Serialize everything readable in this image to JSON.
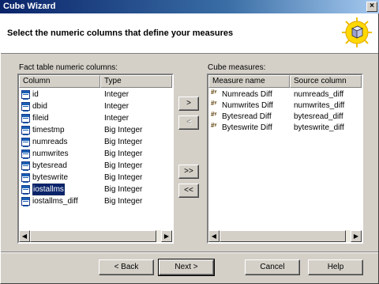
{
  "window": {
    "title": "Cube Wizard",
    "close_label": "×"
  },
  "header": {
    "instruction": "Select the numeric columns that define your measures",
    "icon": "cube-wizard-icon"
  },
  "fact_table": {
    "label": "Fact table numeric columns:",
    "columns": [
      "Column",
      "Type"
    ],
    "rows": [
      {
        "name": "id",
        "type": "Integer"
      },
      {
        "name": "dbid",
        "type": "Integer"
      },
      {
        "name": "fileid",
        "type": "Integer"
      },
      {
        "name": "timestmp",
        "type": "Big Integer"
      },
      {
        "name": "numreads",
        "type": "Big Integer"
      },
      {
        "name": "numwrites",
        "type": "Big Integer"
      },
      {
        "name": "bytesread",
        "type": "Big Integer"
      },
      {
        "name": "byteswrite",
        "type": "Big Integer"
      },
      {
        "name": "iostallms",
        "type": "Big Integer"
      },
      {
        "name": "iostallms_diff",
        "type": "Big Integer"
      }
    ],
    "selected_row": "iostallms"
  },
  "cube_measures": {
    "label": "Cube measures:",
    "columns": [
      "Measure name",
      "Source column"
    ],
    "rows": [
      {
        "name": "Numreads Diff",
        "source": "numreads_diff"
      },
      {
        "name": "Numwrites Diff",
        "source": "numwrites_diff"
      },
      {
        "name": "Bytesread Diff",
        "source": "bytesread_diff"
      },
      {
        "name": "Byteswrite Diff",
        "source": "byteswrite_diff"
      }
    ]
  },
  "transfer_buttons": {
    "add": ">",
    "remove": "<",
    "add_all": ">>",
    "remove_all": "<<"
  },
  "footer": {
    "back": "< Back",
    "next": "Next >",
    "cancel": "Cancel",
    "help": "Help"
  }
}
